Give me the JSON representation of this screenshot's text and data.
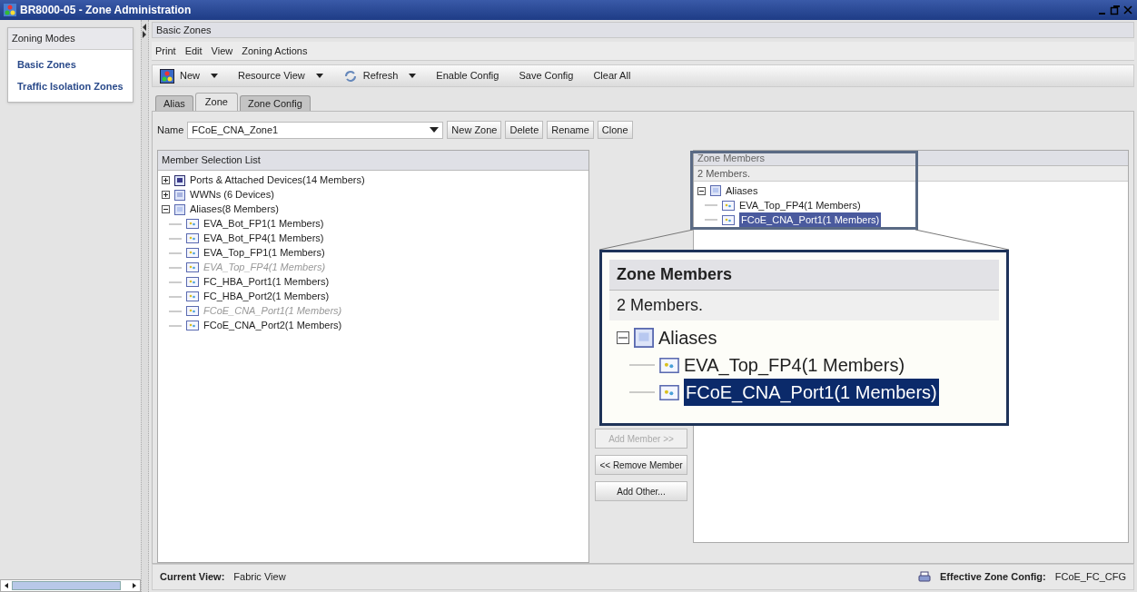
{
  "window": {
    "title": "BR8000-05 - Zone Administration"
  },
  "sidebar": {
    "title": "Zoning Modes",
    "items": [
      {
        "label": "Basic Zones"
      },
      {
        "label": "Traffic Isolation Zones"
      }
    ]
  },
  "main": {
    "title": "Basic Zones"
  },
  "menu": [
    "Print",
    "Edit",
    "View",
    "Zoning Actions"
  ],
  "toolbar": [
    {
      "label": "New",
      "kind": "dropdown"
    },
    {
      "label": "Resource View",
      "kind": "dropdown"
    },
    {
      "label": "Refresh",
      "kind": "dropdown"
    },
    {
      "label": "Enable Config",
      "kind": "button"
    },
    {
      "label": "Save Config",
      "kind": "button"
    },
    {
      "label": "Clear All",
      "kind": "button"
    }
  ],
  "tabs": [
    {
      "label": "Alias",
      "selected": false
    },
    {
      "label": "Zone",
      "selected": true
    },
    {
      "label": "Zone Config",
      "selected": false
    }
  ],
  "name_field": {
    "label": "Name",
    "value": "FCoE_CNA_Zone1"
  },
  "zone_buttons": [
    "New Zone",
    "Delete",
    "Rename",
    "Clone"
  ],
  "member_selection": {
    "title": "Member Selection List",
    "tree": [
      {
        "label": "Ports & Attached Devices(14 Members)",
        "kind": "ports",
        "expanded": false
      },
      {
        "label": "WWNs (6 Devices)",
        "kind": "wwns",
        "expanded": false
      },
      {
        "label": "Aliases(8 Members)",
        "kind": "aliases",
        "expanded": true,
        "children": [
          {
            "label": "EVA_Bot_FP1(1 Members)",
            "disabled": false
          },
          {
            "label": "EVA_Bot_FP4(1 Members)",
            "disabled": false
          },
          {
            "label": "EVA_Top_FP1(1 Members)",
            "disabled": false
          },
          {
            "label": "EVA_Top_FP4(1 Members)",
            "disabled": true
          },
          {
            "label": "FC_HBA_Port1(1 Members)",
            "disabled": false
          },
          {
            "label": "FC_HBA_Port2(1 Members)",
            "disabled": false
          },
          {
            "label": "FCoE_CNA_Port1(1 Members)",
            "disabled": true
          },
          {
            "label": "FCoE_CNA_Port2(1 Members)",
            "disabled": false
          }
        ]
      }
    ]
  },
  "transfer_buttons": [
    {
      "label": "Add Member >>",
      "disabled": true
    },
    {
      "label": "<< Remove Member",
      "disabled": false
    },
    {
      "label": "Add Other...",
      "disabled": false
    }
  ],
  "zone_members": {
    "title": "Zone Members",
    "count": "2 Members.",
    "tree": [
      {
        "label": "Aliases",
        "kind": "aliases",
        "expanded": true,
        "children": [
          {
            "label": "EVA_Top_FP4(1 Members)",
            "selected": false
          },
          {
            "label": "FCoE_CNA_Port1(1 Members)",
            "selected": true
          }
        ]
      }
    ]
  },
  "magnified_callout": {
    "title": "Zone Members",
    "count": "2 Members.",
    "tree": [
      {
        "label": "Aliases",
        "kind": "aliases",
        "expanded": true,
        "children": [
          {
            "label": "EVA_Top_FP4(1 Members)",
            "selected": false
          },
          {
            "label": "FCoE_CNA_Port1(1 Members)",
            "selected": true
          }
        ]
      }
    ]
  },
  "status_bar": {
    "view_label": "Current View:",
    "view": "Fabric View",
    "config_label": "Effective Zone Config:",
    "config": "FCoE_FC_CFG"
  }
}
